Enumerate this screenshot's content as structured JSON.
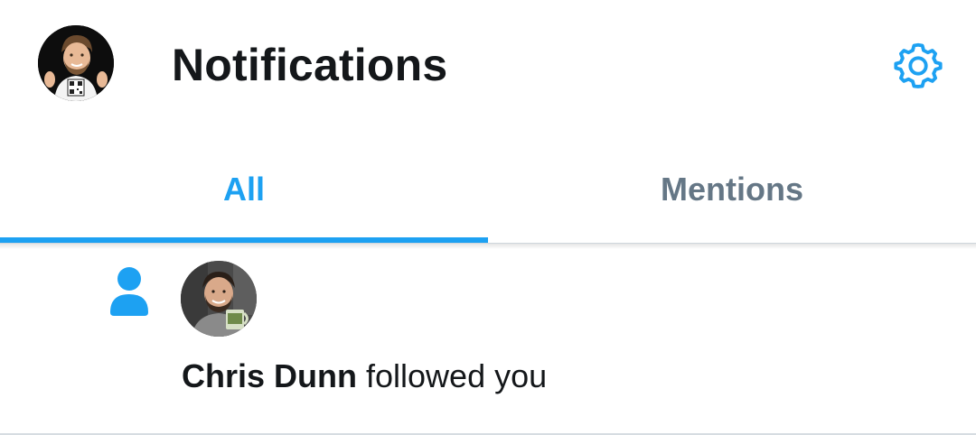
{
  "header": {
    "title": "Notifications",
    "avatar_icon": "profile-avatar",
    "settings_icon": "gear-icon"
  },
  "tabs": [
    {
      "label": "All",
      "active": true
    },
    {
      "label": "Mentions",
      "active": false
    }
  ],
  "notifications": [
    {
      "type_icon": "person-icon",
      "user_name": "Chris Dunn",
      "action_text": " followed you"
    }
  ],
  "colors": {
    "accent": "#1da1f2",
    "text_primary": "#14171a",
    "text_secondary": "#657786"
  }
}
